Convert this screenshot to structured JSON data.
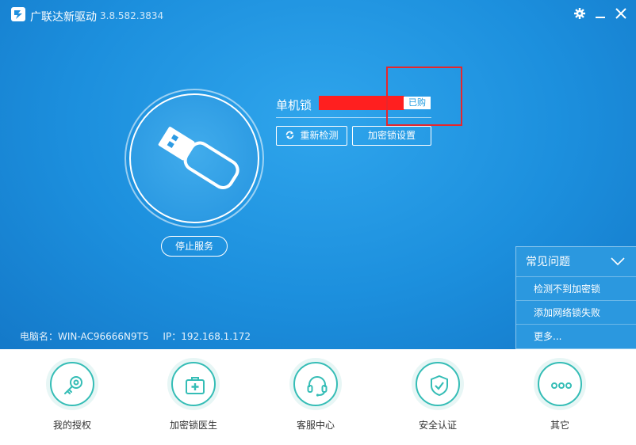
{
  "app": {
    "title": "广联达新驱动",
    "version": "3.8.582.3834"
  },
  "device": {
    "name": "单机锁",
    "id_redacted": "",
    "status_badge": "已购",
    "refresh_label": "重新检测",
    "settings_label": "加密锁设置",
    "stop_service_label": "停止服务"
  },
  "computer": {
    "name_label": "电脑名：",
    "name_value": "WIN-AC96666N9T5",
    "ip_label": "IP：",
    "ip_value": "192.168.1.172"
  },
  "faq": {
    "title": "常见问题",
    "items": [
      "检测不到加密锁",
      "添加网络锁失败",
      "更多..."
    ]
  },
  "nav": [
    {
      "label": "我的授权",
      "icon": "key-icon"
    },
    {
      "label": "加密锁医生",
      "icon": "medical-kit-icon"
    },
    {
      "label": "客服中心",
      "icon": "headset-icon"
    },
    {
      "label": "安全认证",
      "icon": "shield-check-icon"
    },
    {
      "label": "其它",
      "icon": "more-dots-icon"
    }
  ],
  "colors": {
    "primary_blue": "#1e90df",
    "accent_teal": "#35bdb6",
    "highlight_red": "#e8262b"
  }
}
